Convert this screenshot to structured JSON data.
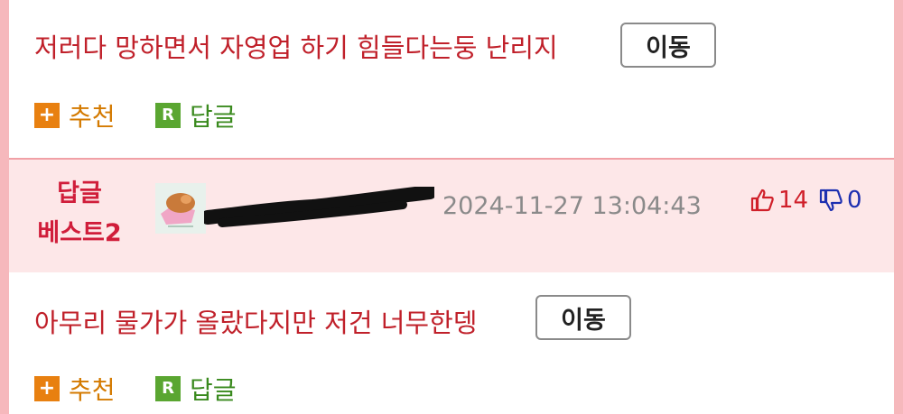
{
  "comments": [
    {
      "text": "저러다 망하면서 자영업 하기 힘들다는둥 난리지",
      "move_label": "이동"
    },
    {
      "text": "아무리 물가가 올랐다지만 저건 너무한뎅",
      "move_label": "이동"
    }
  ],
  "actions": {
    "recommend_label": "추천",
    "reply_label": "답글",
    "recommend_icon": "+",
    "reply_icon": "R"
  },
  "best_reply": {
    "label_line1": "답글",
    "label_line2": "베스트2",
    "timestamp": "2024-11-27 13:04:43",
    "upvotes": "14",
    "downvotes": "0"
  },
  "colors": {
    "accent": "#c0202a",
    "best_bg": "#fde7e8",
    "frame": "#f6b8bc",
    "recommend": "#e88010",
    "reply": "#5aa631"
  }
}
